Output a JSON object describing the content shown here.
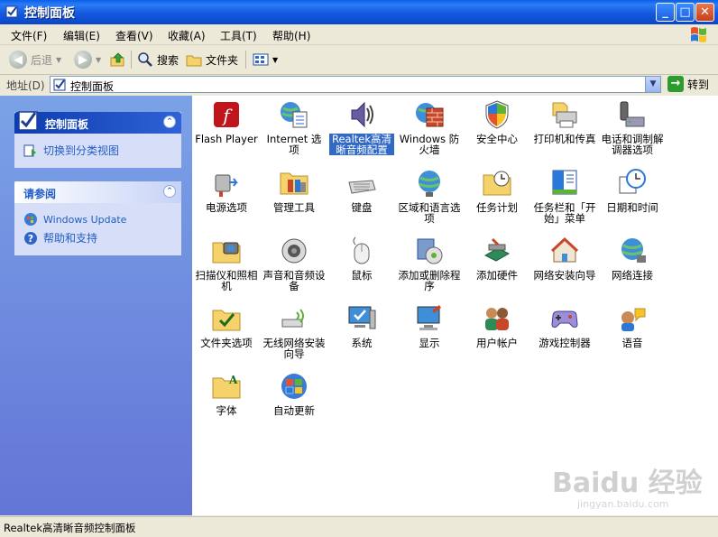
{
  "window": {
    "title": "控制面板"
  },
  "menu": [
    "文件(F)",
    "编辑(E)",
    "查看(V)",
    "收藏(A)",
    "工具(T)",
    "帮助(H)"
  ],
  "toolbar": {
    "back": "后退",
    "search": "搜索",
    "folders": "文件夹"
  },
  "address": {
    "label": "地址(D)",
    "value": "控制面板",
    "go": "转到"
  },
  "sidebar": {
    "panel1": {
      "title": "控制面板",
      "link": "切换到分类视图"
    },
    "panel2": {
      "title": "请参阅",
      "links": [
        "Windows Update",
        "帮助和支持"
      ]
    }
  },
  "items": [
    [
      "Flash Player",
      "Internet 选项",
      "Realtek高清晰音频配置",
      "Windows 防火墙",
      "安全中心",
      "打印机和传真",
      "电话和调制解调器选项"
    ],
    [
      "电源选项",
      "管理工具",
      "键盘",
      "区域和语言选项",
      "任务计划",
      "任务栏和「开始」菜单",
      "日期和时间"
    ],
    [
      "扫描仪和照相机",
      "声音和音频设备",
      "鼠标",
      "添加或删除程序",
      "添加硬件",
      "网络安装向导",
      "网络连接"
    ],
    [
      "文件夹选项",
      "无线网络安装向导",
      "系统",
      "显示",
      "用户帐户",
      "游戏控制器",
      "语音"
    ],
    [
      "字体",
      "自动更新"
    ]
  ],
  "status": "Realtek高清晰音频控制面板",
  "watermark": {
    "brand": "Baidu 经验",
    "url": "jingyan.baidu.com"
  }
}
